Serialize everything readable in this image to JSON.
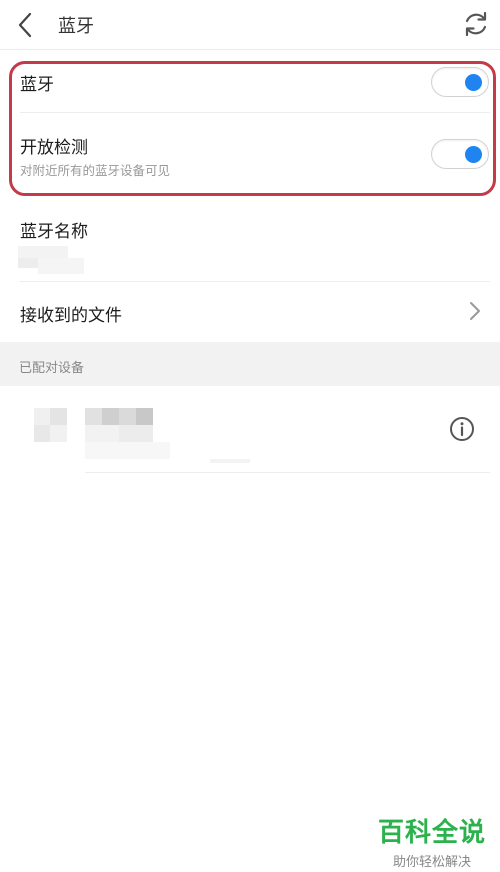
{
  "header": {
    "title": "蓝牙",
    "back_icon": "back-arrow-icon",
    "refresh_icon": "refresh-icon"
  },
  "bluetooth": {
    "label": "蓝牙",
    "enabled": true
  },
  "discoverable": {
    "label": "开放检测",
    "description": "对附近所有的蓝牙设备可见",
    "enabled": true
  },
  "device_name": {
    "label": "蓝牙名称"
  },
  "received_files": {
    "label": "接收到的文件",
    "icon": "chevron-right-icon"
  },
  "paired_section": {
    "title": "已配对设备"
  },
  "paired_device": {
    "info_icon": "info-icon"
  },
  "watermark": {
    "main": "百科全说",
    "sub": "助你轻松解决"
  },
  "colors": {
    "accent": "#1f84f0",
    "highlight": "#c33a48",
    "watermark": "#2bb24c"
  }
}
